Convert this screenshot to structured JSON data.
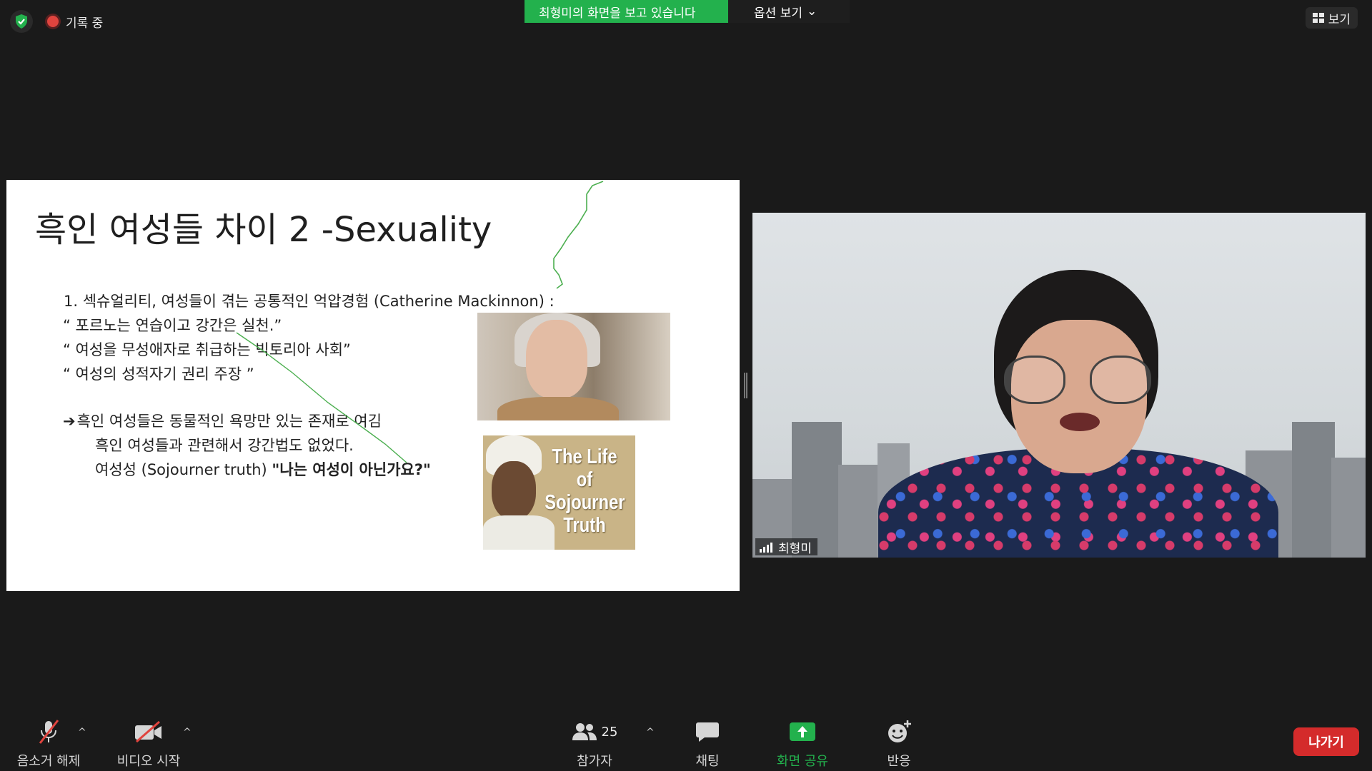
{
  "top_bar": {
    "recording_label": "기록 중",
    "share_banner": "최형미의 화면을 보고 있습니다",
    "view_options": "옵션 보기",
    "view_button": "보기"
  },
  "slide": {
    "title": "흑인 여성들 차이 2  -Sexuality",
    "lines": [
      "1. 섹슈얼리티, 여성들이 겪는 공통적인 억압경험 (Catherine Mackinnon) :",
      "“ 포르노는 연습이고 강간은 실천.”",
      "“ 여성을 무성애자로 취급하는 빅토리아 사회”",
      "“ 여성의 성적자기 권리 주장 ”",
      "흑인 여성들은 동물적인 욕망만 있는 존재로 여김",
      "흑인 여성들과 관련해서 강간법도 없었다.",
      "여성성 (Sojourner truth) ",
      "\"나는 여성이 아닌가요?\""
    ],
    "arrow": "➔",
    "image2_caption": "The Life of Sojourner Truth"
  },
  "video": {
    "participant_name": "최형미"
  },
  "toolbar": {
    "mute": "음소거 해제",
    "video": "비디오 시작",
    "participants": "참가자",
    "participants_count": "25",
    "chat": "채팅",
    "share": "화면 공유",
    "reactions": "반응",
    "leave": "나가기",
    "caret": "^"
  },
  "colors": {
    "background": "#1a1a1a",
    "share_green": "#23b14d",
    "leave_red": "#d42b2b",
    "recording_red": "#e0443e"
  }
}
